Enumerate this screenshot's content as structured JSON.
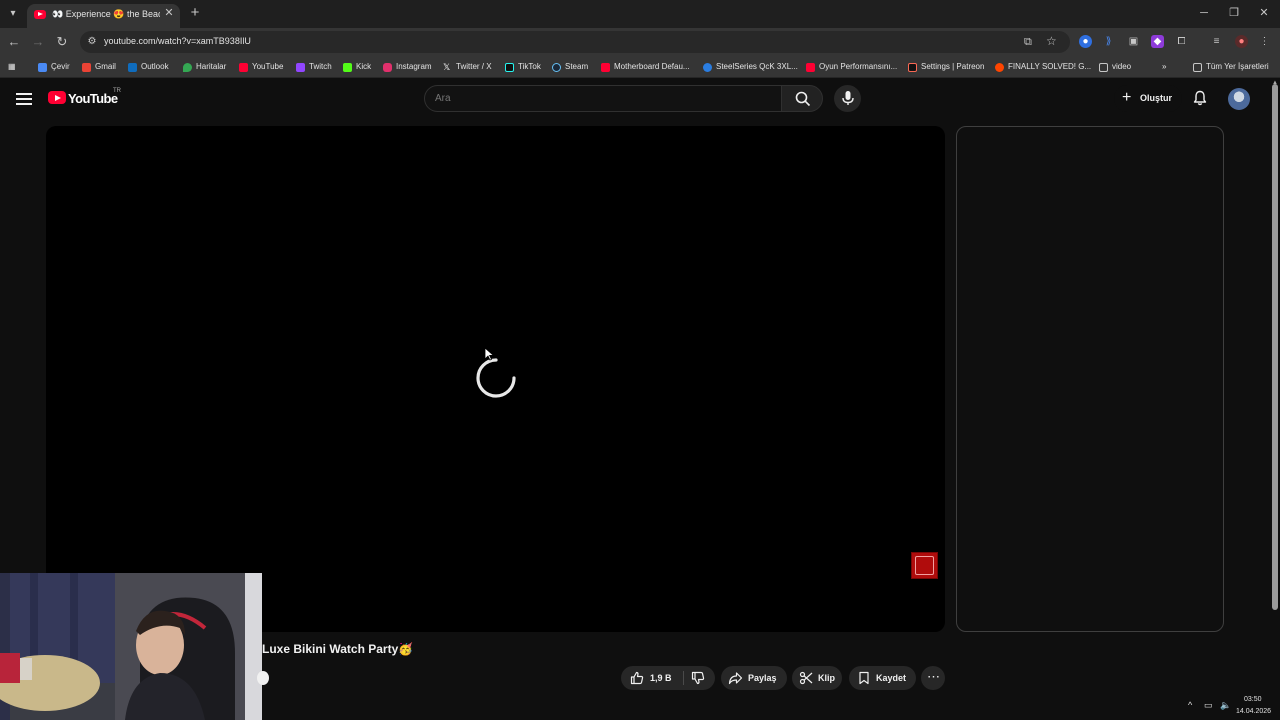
{
  "browser": {
    "tab": {
      "title": "👀 Experience 😍 the Beach Club"
    },
    "url": "youtube.com/watch?v=xamTB938IlU",
    "bookmarks": [
      {
        "label": "Çevir",
        "icon": "translate-icon",
        "color": "#4a8af4"
      },
      {
        "label": "Gmail",
        "icon": "gmail-icon",
        "color": "#ea4335"
      },
      {
        "label": "Outlook",
        "icon": "outlook-icon",
        "color": "#0f6cbd"
      },
      {
        "label": "Haritalar",
        "icon": "maps-icon",
        "color": "#34a853"
      },
      {
        "label": "YouTube",
        "icon": "youtube-icon",
        "color": "#ff0033"
      },
      {
        "label": "Twitch",
        "icon": "twitch-icon",
        "color": "#9146ff"
      },
      {
        "label": "Kick",
        "icon": "kick-icon",
        "color": "#53fc18"
      },
      {
        "label": "Instagram",
        "icon": "instagram-icon",
        "color": "#e1306c"
      },
      {
        "label": "Twitter / X",
        "icon": "x-icon",
        "color": "#ffffff"
      },
      {
        "label": "TikTok",
        "icon": "tiktok-icon",
        "color": "#111111"
      },
      {
        "label": "Steam",
        "icon": "steam-icon",
        "color": "#1b2838"
      },
      {
        "label": "Motherboard Defau...",
        "icon": "youtube-icon",
        "color": "#ff0033"
      },
      {
        "label": "SteelSeries QcK 3XL...",
        "icon": "steelseries-icon",
        "color": "#2a7de1"
      },
      {
        "label": "Oyun Performansını...",
        "icon": "youtube-icon",
        "color": "#ff0033"
      },
      {
        "label": "Settings | Patreon",
        "icon": "patreon-icon",
        "color": "#f96854"
      },
      {
        "label": "FINALLY SOLVED! G...",
        "icon": "reddit-icon",
        "color": "#ff4500"
      },
      {
        "label": "video",
        "icon": "folder-icon",
        "color": "#c7c7c7"
      }
    ],
    "all_bookmarks": "Tüm Yer İşaretleri"
  },
  "youtube": {
    "logo_text": "YouTube",
    "country_code": "TR",
    "search_placeholder": "Ara",
    "create_label": "Oluştur",
    "video_title": "Luxe Bikini Watch Party🥳",
    "actions": {
      "likes": "1,9 B",
      "share": "Paylaş",
      "clip": "Klip",
      "save": "Kaydet"
    }
  },
  "system": {
    "time": "03:50",
    "date": "14.04.2026"
  }
}
